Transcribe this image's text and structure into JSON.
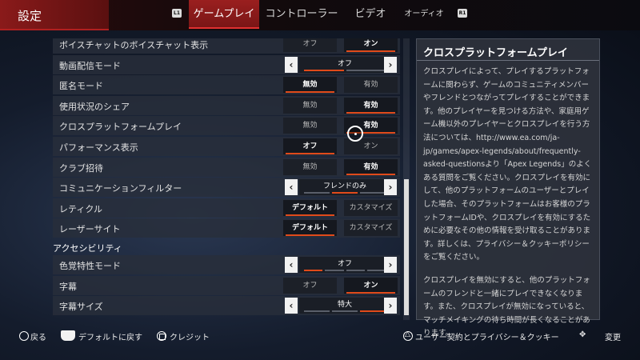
{
  "header": {
    "title": "設定",
    "l1": "L1",
    "r1": "R1",
    "tabs": [
      "ゲームプレイ",
      "コントローラー",
      "ビデオ",
      "オーディオ"
    ]
  },
  "settings": [
    {
      "label": "ボイスチャットのボイスチャット表示",
      "type": "toggle",
      "options": [
        "オフ",
        "オン"
      ],
      "selected": 1
    },
    {
      "label": "動画配信モード",
      "type": "select",
      "value": "オフ",
      "steps": 2,
      "index": 0
    },
    {
      "label": "匿名モード",
      "type": "toggle",
      "options": [
        "無効",
        "有効"
      ],
      "selected": 0
    },
    {
      "label": "使用状況のシェア",
      "type": "toggle",
      "options": [
        "無効",
        "有効"
      ],
      "selected": 1
    },
    {
      "label": "クロスプラットフォームプレイ",
      "type": "toggle",
      "options": [
        "無効",
        "有効"
      ],
      "selected": 1
    },
    {
      "label": "パフォーマンス表示",
      "type": "toggle",
      "options": [
        "オフ",
        "オン"
      ],
      "selected": 0
    },
    {
      "label": "クラブ招待",
      "type": "toggle",
      "options": [
        "無効",
        "有効"
      ],
      "selected": 1
    },
    {
      "label": "コミュニケーションフィルター",
      "type": "select",
      "value": "フレンドのみ",
      "steps": 3,
      "index": 1
    },
    {
      "label": "レティクル",
      "type": "toggle",
      "options": [
        "デフォルト",
        "カスタマイズ"
      ],
      "selected": 0
    },
    {
      "label": "レーザーサイト",
      "type": "toggle",
      "options": [
        "デフォルト",
        "カスタマイズ"
      ],
      "selected": 0
    }
  ],
  "section_title": "アクセシビリティ",
  "accessibility": [
    {
      "label": "色覚特性モード",
      "type": "select",
      "value": "オフ",
      "steps": 4,
      "index": 0
    },
    {
      "label": "字幕",
      "type": "toggle",
      "options": [
        "オフ",
        "オン"
      ],
      "selected": 1
    },
    {
      "label": "字幕サイズ",
      "type": "select",
      "value": "特大",
      "steps": 3,
      "index": 2
    }
  ],
  "info": {
    "title": "クロスプラットフォームプレイ",
    "para1": "クロスプレイによって、プレイするプラットフォームに関わらず、ゲームのコミュニティメンバーやフレンドとつながってプレイすることができます。他のプレイヤーを見つける方法や、家庭用ゲーム機以外のプレイヤーとクロスプレイを行う方法については、http://www.ea.com/ja-jp/games/apex-legends/about/frequently-asked-questionsより「Apex Legends」のよくある質問をご覧ください。クロスプレイを有効にして、他のプラットフォームのユーザーとプレイした場合、そのプラットフォームはお客様のプラットフォームIDや、クロスプレイを有効にするために必要なその他の情報を受け取ることがあります。詳しくは、プライバシー＆クッキーポリシーをご覧ください。",
    "para2": "クロスプレイを無効にすると、他のプラットフォームのフレンドと一緒にプレイできなくなります。また、クロスプレイが無効になっていると、マッチメイキングの待ち時間が長くなることがあります。"
  },
  "footer": {
    "back": "戻る",
    "reset": "デフォルトに戻す",
    "credits": "クレジット",
    "terms": "ユーザー契約とプライバシー＆クッキー",
    "change": "変更"
  },
  "colors": {
    "accent": "#e04a1a",
    "header_red": "#8a1a1a"
  }
}
